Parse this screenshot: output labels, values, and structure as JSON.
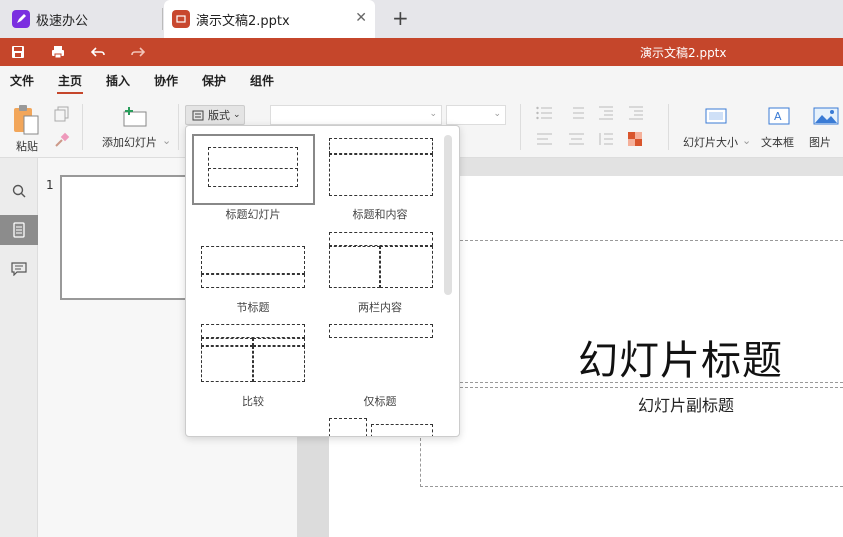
{
  "tabs": [
    {
      "label": "极速办公",
      "icon": "rocket-icon"
    },
    {
      "label": "演示文稿2.pptx",
      "icon": "presentation-icon"
    }
  ],
  "title_bar": {
    "doc_title": "演示文稿2.pptx"
  },
  "menu": {
    "items": [
      "文件",
      "主页",
      "插入",
      "协作",
      "保护",
      "组件"
    ],
    "active": "主页"
  },
  "ribbon": {
    "paste_label": "粘贴",
    "add_slide_label": "添加幻灯片",
    "layout_label": "版式",
    "slide_size_label": "幻灯片大小",
    "textbox_label": "文本框",
    "picture_label": "图片"
  },
  "thumbnails": {
    "slide_number": "1"
  },
  "slide": {
    "title": "幻灯片标题",
    "subtitle": "幻灯片副标题"
  },
  "layouts": [
    {
      "label": "标题幻灯片"
    },
    {
      "label": "标题和内容"
    },
    {
      "label": "节标题"
    },
    {
      "label": "两栏内容"
    },
    {
      "label": "比较"
    },
    {
      "label": "仅标题"
    }
  ],
  "colors": {
    "accent": "#c5462b",
    "tab_home_icon": "#7b2fe0"
  }
}
